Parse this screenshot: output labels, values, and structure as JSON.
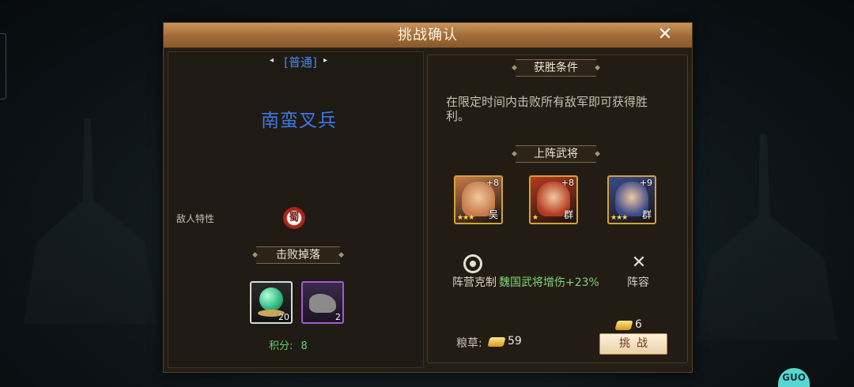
{
  "dialog": {
    "title": "挑战确认",
    "close_glyph": "✕"
  },
  "left": {
    "difficulty": "[普通]",
    "prev_glyph": "◂",
    "next_glyph": "▸",
    "enemy_name": "南蛮叉兵",
    "trait_label": "敌人特性",
    "trait_badge": "蜀",
    "drops_title": "击败掉落",
    "drops": [
      {
        "name": "jade-orb",
        "count": "20",
        "rarity": "white"
      },
      {
        "name": "stone-beast",
        "count": "2",
        "rarity": "purple"
      }
    ],
    "score_label": "积分:",
    "score_value": "8"
  },
  "right": {
    "win_title": "获胜条件",
    "win_text": "在限定时间内击败所有敌军即可获得胜利。",
    "heroes_title": "上阵武将",
    "heroes": [
      {
        "level": "+8",
        "faction": "吴",
        "stars": "★★★",
        "color": "#c77a4a"
      },
      {
        "level": "+8",
        "faction": "群",
        "stars": "★",
        "color": "#b43a1e"
      },
      {
        "level": "+9",
        "faction": "群",
        "stars": "★★★",
        "color": "#3a4a8a"
      }
    ],
    "faction_label": "阵营克制",
    "faction_desc": "魏国武将增伤+23%",
    "lineup_label": "阵容",
    "grain_label": "粮草:",
    "grain_value": "59",
    "cost_value": "6",
    "challenge_button": "挑战"
  },
  "colors": {
    "accent_blue": "#3a7ae8",
    "green_text": "#7ed476",
    "title_bar": "#a06a36"
  }
}
